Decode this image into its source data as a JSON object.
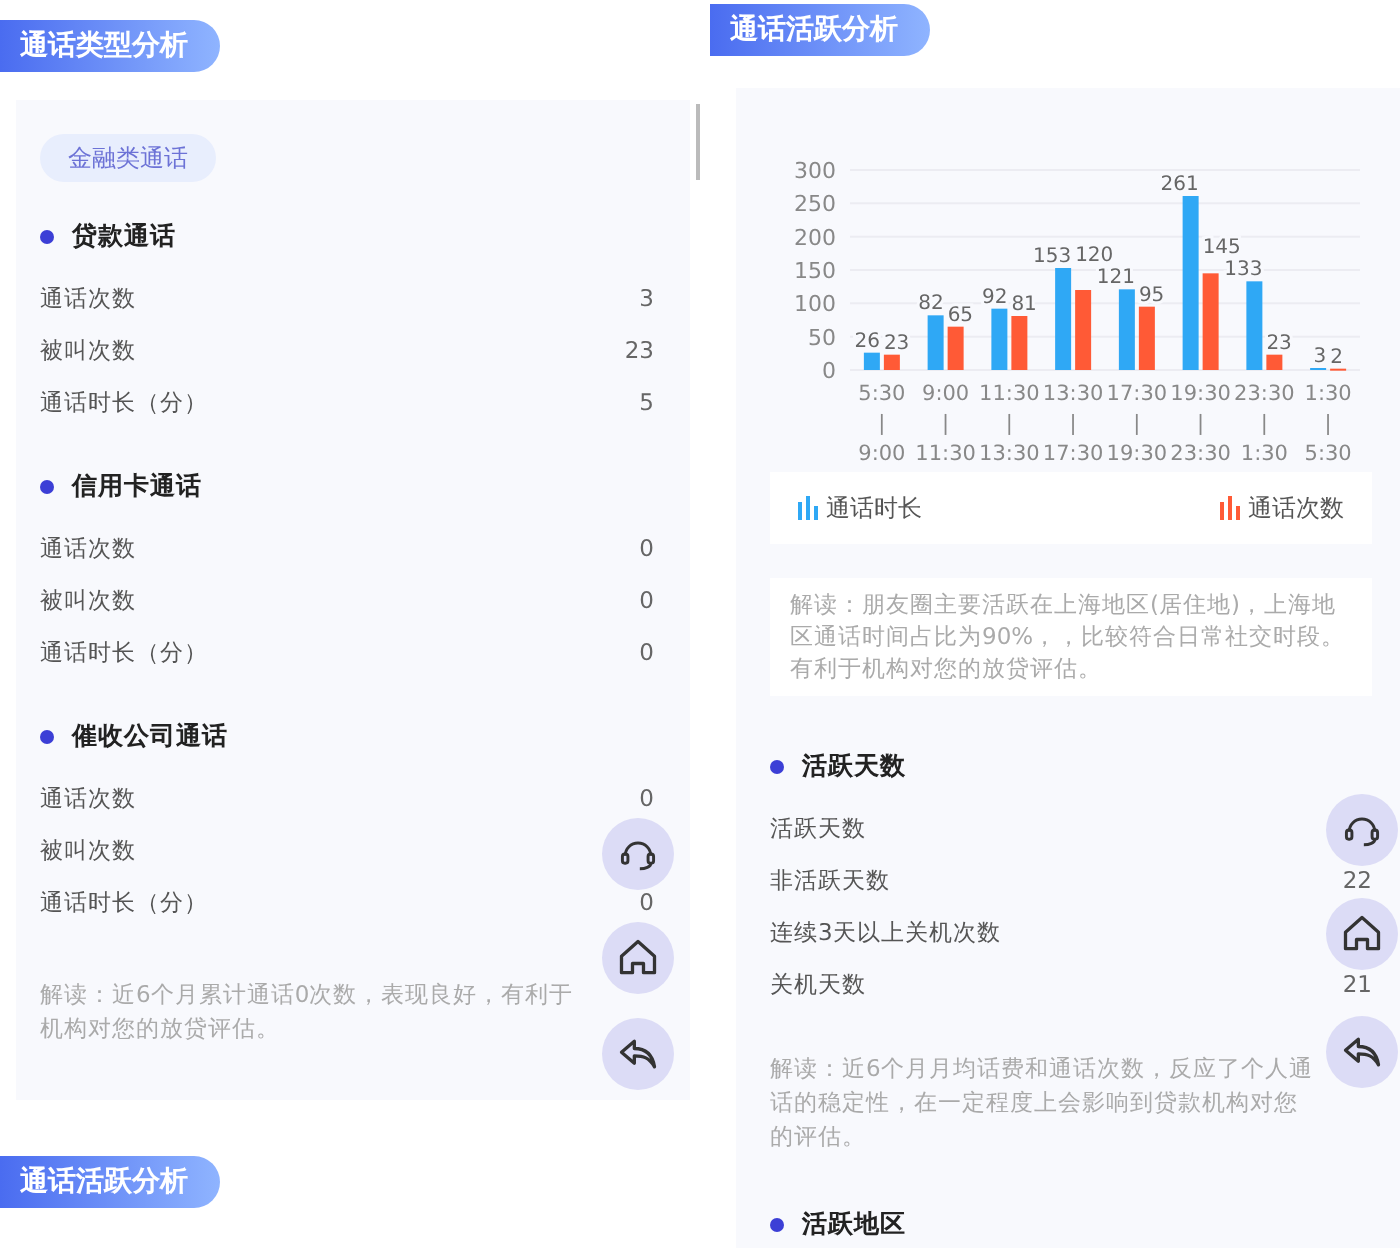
{
  "left_panel": {
    "section_title": "通话类型分析",
    "tag": "金融类通话",
    "groups": [
      {
        "title": "贷款通话",
        "rows": [
          {
            "label": "通话次数",
            "value": "3"
          },
          {
            "label": "被叫次数",
            "value": "23"
          },
          {
            "label": "通话时长（分）",
            "value": "5"
          }
        ]
      },
      {
        "title": "信用卡通话",
        "rows": [
          {
            "label": "通话次数",
            "value": "0"
          },
          {
            "label": "被叫次数",
            "value": "0"
          },
          {
            "label": "通话时长（分）",
            "value": "0"
          }
        ]
      },
      {
        "title": "催收公司通话",
        "rows": [
          {
            "label": "通话次数",
            "value": "0"
          },
          {
            "label": "被叫次数"
          },
          {
            "label": "通话时长（分）",
            "value": "0"
          }
        ]
      }
    ],
    "note": "解读：近6个月累计通话0次数，表现良好，有利于机构对您的放贷评估。",
    "next_section_title": "通话活跃分析"
  },
  "right_panel": {
    "section_title": "通话活跃分析",
    "chart_data": {
      "type": "bar",
      "categories": [
        "5:30\n|\n9:00",
        "9:00\n|\n11:30",
        "11:30\n|\n13:30",
        "13:30\n|\n17:30",
        "17:30\n|\n19:30",
        "19:30\n|\n23:30",
        "23:30\n|\n1:30",
        "1:30\n|\n5:30"
      ],
      "series": [
        {
          "name": "通话时长",
          "color": "#2fa8f5",
          "values": [
            26,
            82,
            92,
            153,
            121,
            261,
            133,
            3
          ]
        },
        {
          "name": "通话次数",
          "color": "#ff5a36",
          "values": [
            23,
            65,
            81,
            120,
            95,
            145,
            23,
            2
          ]
        }
      ],
      "ylim": [
        0,
        300
      ],
      "yticks": [
        0,
        50,
        100,
        150,
        200,
        250,
        300
      ],
      "grid": true,
      "data_labels": true
    },
    "chart_note": "解读：朋友圈主要活跃在上海地区(居住地)，上海地区通话时间占比为90%，，比较符合日常社交时段。有利于机构对您的放贷评估。",
    "groups": [
      {
        "title": "活跃天数",
        "rows": [
          {
            "label": "活跃天数"
          },
          {
            "label": "非活跃天数",
            "value": "22"
          },
          {
            "label": "连续3天以上关机次数"
          },
          {
            "label": "关机天数",
            "value": "21"
          }
        ],
        "note": "解读：近6个月月均话费和通话次数，反应了个人通话的稳定性，在一定程度上会影响到贷款机构对您的评估。"
      },
      {
        "title": "活跃地区"
      }
    ]
  }
}
